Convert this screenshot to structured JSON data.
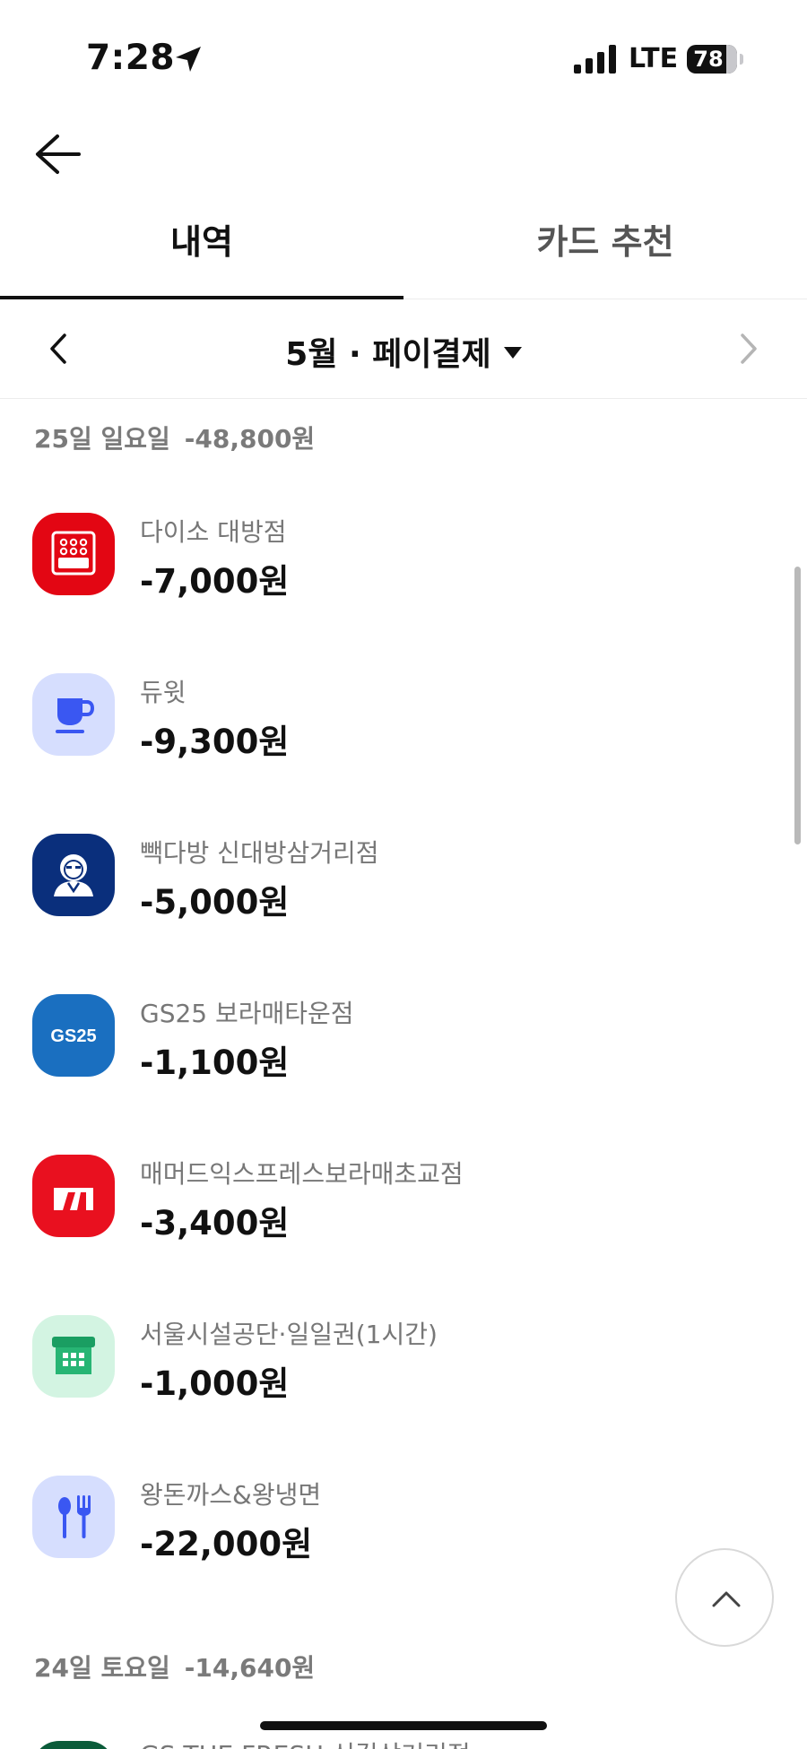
{
  "status_bar": {
    "time": "7:28",
    "network": "LTE",
    "battery": "78"
  },
  "header": {
    "back_icon": "arrow-left-icon"
  },
  "tabs": [
    {
      "label": "내역",
      "active": true
    },
    {
      "label": "카드 추천",
      "active": false
    }
  ],
  "month_nav": {
    "title": "5월 · 페이결제",
    "prev_icon": "chevron-left-icon",
    "next_icon": "chevron-right-icon"
  },
  "days": [
    {
      "date": "25일 일요일",
      "total": "-48,800원",
      "transactions": [
        {
          "name": "다이소 대방점",
          "amount": "-7,000원",
          "icon": "daiso-logo-icon",
          "color": "#e30613"
        },
        {
          "name": "듀윗",
          "amount": "-9,300원",
          "icon": "coffee-cup-icon",
          "color": "#d6defe"
        },
        {
          "name": "빽다방 신대방삼거리점",
          "amount": "-5,000원",
          "icon": "paikdabang-logo-icon",
          "color": "#0a2f7c"
        },
        {
          "name": "GS25 보라매타운점",
          "amount": "-1,100원",
          "icon": "gs25-logo-icon",
          "color": "#1a6fc0",
          "logo_text": "GS25"
        },
        {
          "name": "매머드익스프레스보라매초교점",
          "amount": "-3,400원",
          "icon": "mammoth-logo-icon",
          "color": "#e9101f"
        },
        {
          "name": "서울시설공단·일일권(1시간)",
          "amount": "-1,000원",
          "icon": "store-icon",
          "color": "#d3f4e2"
        },
        {
          "name": "왕돈까스&왕냉면",
          "amount": "-22,000원",
          "icon": "spoon-fork-icon",
          "color": "#d6defe"
        }
      ]
    },
    {
      "date": "24일 토요일",
      "total": "-14,640원",
      "transactions": [
        {
          "name": "GS THE FRESH 신길삼거리점",
          "icon": "gs-the-fresh-logo-icon",
          "color": "#0b5c3a"
        }
      ]
    }
  ],
  "scroll_top_icon": "chevron-up-icon"
}
